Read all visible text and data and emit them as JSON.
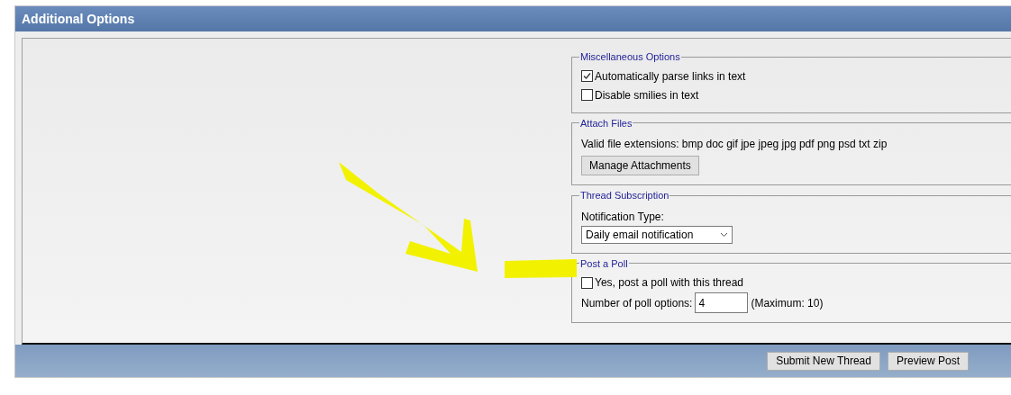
{
  "window": {
    "title": "Additional Options"
  },
  "sections": [
    {
      "kind": "checkboxes",
      "legend": "Miscellaneous Options",
      "items": [
        {
          "label": "Automatically parse links in text",
          "checked": true
        },
        {
          "label": "Disable smilies in text",
          "checked": false
        }
      ]
    },
    {
      "kind": "attachments",
      "legend": "Attach Files",
      "text": "Valid file extensions: bmp doc gif jpe jpeg jpg pdf png psd txt zip",
      "button": "Manage Attachments"
    },
    {
      "kind": "select",
      "legend": "Thread Subscription",
      "label": "Notification Type:",
      "value": "Daily email notification"
    },
    {
      "kind": "poll",
      "legend": "Post a Poll",
      "checkbox": {
        "label": "Yes, post a poll with this thread",
        "checked": false
      },
      "field_label": "Number of poll options:",
      "field_value": "4",
      "note": "(Maximum: 10)"
    }
  ],
  "buttons": [
    "Submit New Thread",
    "Preview Post"
  ]
}
